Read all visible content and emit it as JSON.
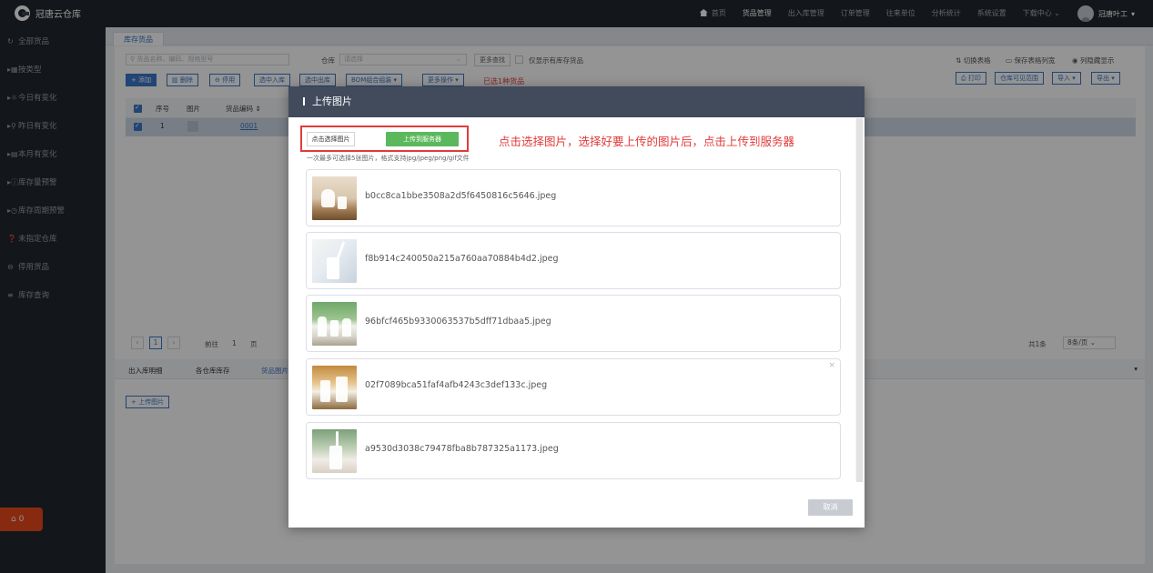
{
  "app": {
    "name": "冠唐云仓库"
  },
  "topnav": {
    "items": [
      "首页",
      "货品管理",
      "出入库管理",
      "订单管理",
      "往来单位",
      "分析统计",
      "系统设置",
      "下载中心"
    ],
    "active": "货品管理",
    "user": "冠唐叶工"
  },
  "sidebar": {
    "items": [
      {
        "icon": "refresh-icon",
        "glyph": "↻",
        "label": "全部货品"
      },
      {
        "icon": "grid-icon",
        "glyph": "▸▦",
        "label": "按类型"
      },
      {
        "icon": "sun-icon",
        "glyph": "▸☼",
        "label": "今日有变化"
      },
      {
        "icon": "sunset-icon",
        "glyph": "▸⚲",
        "label": "昨日有变化"
      },
      {
        "icon": "calendar-icon",
        "glyph": "▸▤",
        "label": "本月有变化"
      },
      {
        "icon": "warning-icon",
        "glyph": "▸ⓘ",
        "label": "库存量预警"
      },
      {
        "icon": "clock-icon",
        "glyph": "▸◷",
        "label": "库存周期预警"
      },
      {
        "icon": "question-icon",
        "glyph": "❓",
        "label": "未指定仓库"
      },
      {
        "icon": "minus-circle-icon",
        "glyph": "⊖",
        "label": "停用货品"
      },
      {
        "icon": "list-icon",
        "glyph": "≡",
        "label": "库存查询"
      }
    ],
    "badge": "0"
  },
  "main": {
    "tab": "库存货品",
    "search_placeholder": "货品名称、编码、规格型号",
    "warehouse_label": "仓库",
    "warehouse_placeholder": "请选择",
    "more_search": "更多查找",
    "only_stock": "仅显示有库存货品",
    "switch_table": "切换表格",
    "save_columns": "保存表格列宽",
    "hide_columns": "列隐藏显示",
    "toolbar": [
      "+ 添加",
      "删除",
      "停用",
      "选中入库",
      "选中出库",
      "BOM组合组装 ▾",
      "更多操作 ▾"
    ],
    "selected_text": "已选1种货品",
    "right_buttons": [
      "打印",
      "仓库可见范围",
      "导入 ▾",
      "导出 ▾"
    ],
    "columns": [
      "序号",
      "图片",
      "货品编码"
    ],
    "row": {
      "index": "1",
      "code": "0001"
    },
    "pager": {
      "current": "1",
      "goto_label": "前往",
      "goto_value": "1",
      "page_unit": "页",
      "total": "共1条",
      "page_size": "8条/页"
    },
    "bottom_tabs": [
      "出入库明细",
      "各仓库库存",
      "货品图片"
    ],
    "upload_button": "+ 上传图片"
  },
  "modal": {
    "title": "上传图片",
    "choose_button": "点击选择图片",
    "upload_button": "上传到服务器",
    "instruction": "点击选择图片，选择好要上传的图片后，点击上传到服务器",
    "hint": "一次最多可选择5张图片，格式支持jpg/jpeg/png/gif文件",
    "files": [
      "b0cc8ca1bbe3508a2d5f6450816c5646.jpeg",
      "f8b914c240050a215a760aa70884b4d2.jpeg",
      "96bfcf465b9330063537b5dff71dbaa5.jpeg",
      "02f7089bca51faf4afb4243c3def133c.jpeg",
      "a9530d3038c79478fba8b787325a1173.jpeg"
    ],
    "cancel": "取消"
  },
  "colors": {
    "accent": "#3a78c9",
    "danger": "#e23b3b",
    "success": "#5cb85c",
    "header": "#414b5c",
    "dark": "#22272e"
  }
}
